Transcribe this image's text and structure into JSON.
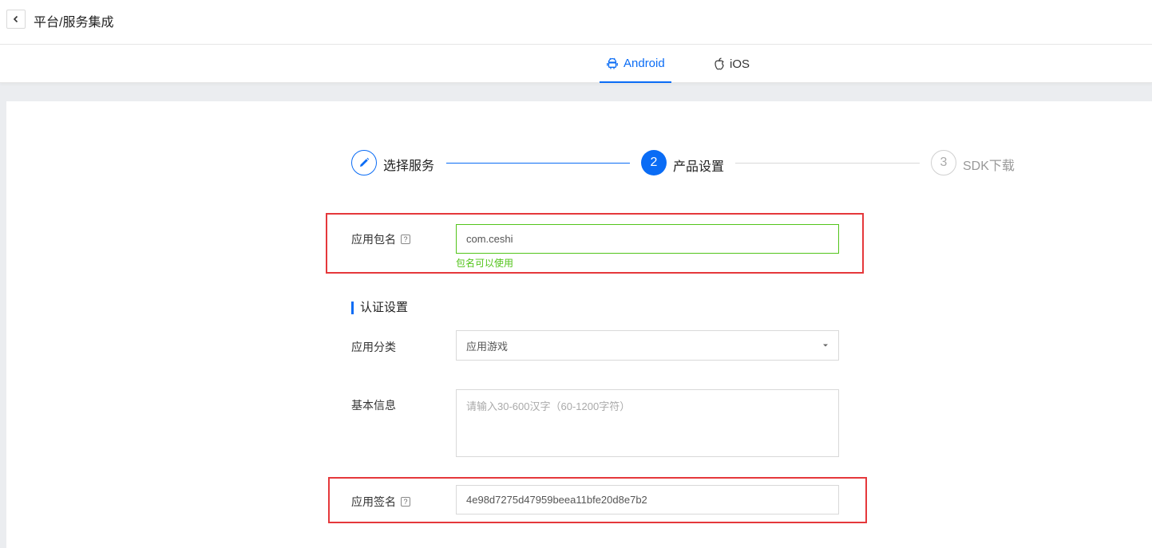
{
  "header": {
    "title": "平台/服务集成"
  },
  "tabs": [
    {
      "label": "Android",
      "icon": "android-icon",
      "active": true
    },
    {
      "label": "iOS",
      "icon": "apple-icon",
      "active": false
    }
  ],
  "steps": [
    {
      "label": "选择服务",
      "marker": "edit-icon",
      "state": "done"
    },
    {
      "label": "产品设置",
      "marker": "2",
      "state": "current"
    },
    {
      "label": "SDK下载",
      "marker": "3",
      "state": "pending"
    }
  ],
  "form": {
    "package_name": {
      "label": "应用包名",
      "value": "com.ceshi",
      "hint": "包名可以使用",
      "help": "?"
    },
    "section_title": "认证设置",
    "category": {
      "label": "应用分类",
      "value": "应用游戏"
    },
    "basic_info": {
      "label": "基本信息",
      "placeholder": "请输入30-600汉字（60-1200字符）"
    },
    "signature": {
      "label": "应用签名",
      "value": "4e98d7275d47959beea11bfe20d8e7b2",
      "help": "?"
    }
  },
  "colors": {
    "accent": "#0a6cf5",
    "success": "#52c41a",
    "highlight_frame": "#e5383b"
  }
}
